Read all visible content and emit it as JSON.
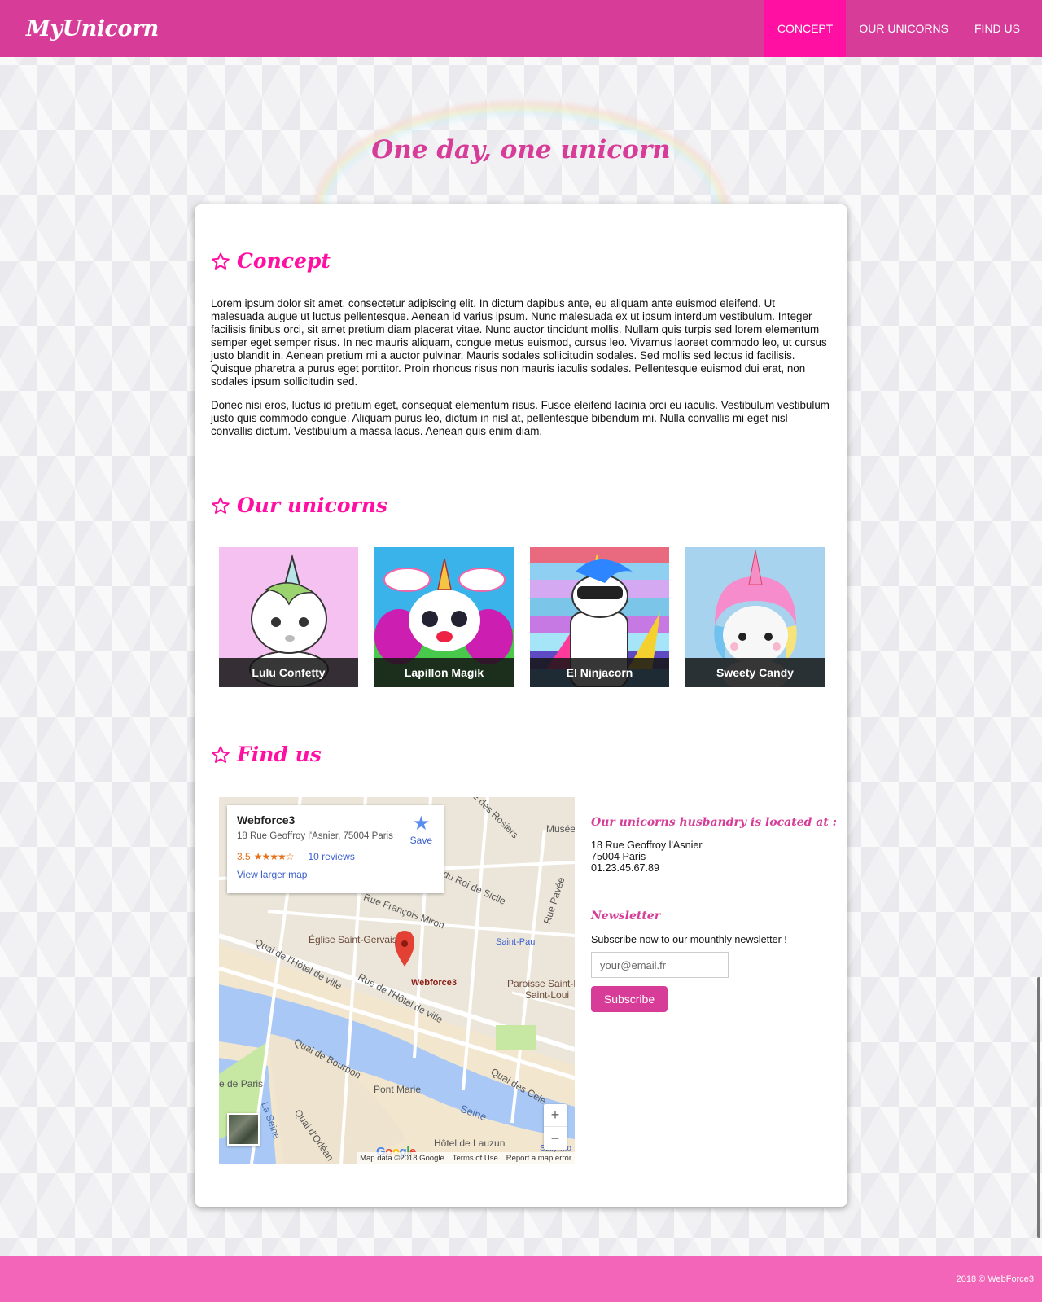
{
  "header": {
    "brand": "MyUnicorn",
    "nav": [
      {
        "label": "CONCEPT",
        "active": true
      },
      {
        "label": "OUR UNICORNS",
        "active": false
      },
      {
        "label": "FIND US",
        "active": false
      }
    ]
  },
  "hero": {
    "title": "One day, one unicorn"
  },
  "concept": {
    "title": "Concept",
    "paragraphs": [
      "Lorem ipsum dolor sit amet, consectetur adipiscing elit. In dictum dapibus ante, eu aliquam ante euismod eleifend. Ut malesuada augue ut luctus pellentesque. Aenean id varius ipsum. Nunc malesuada ex ut ipsum interdum vestibulum. Integer facilisis finibus orci, sit amet pretium diam placerat vitae. Nunc auctor tincidunt mollis. Nullam quis turpis sed lorem elementum semper eget semper risus. In nec mauris aliquam, congue metus euismod, cursus leo. Vivamus laoreet commodo leo, ut cursus justo blandit in. Aenean pretium mi a auctor pulvinar. Mauris sodales sollicitudin sodales. Sed mollis sed lectus id facilisis. Quisque pharetra a purus eget porttitor. Proin rhoncus risus non mauris iaculis sodales. Pellentesque euismod dui erat, non sodales ipsum sollicitudin sed.",
      "Donec nisi eros, luctus id pretium eget, consequat elementum risus. Fusce eleifend lacinia orci eu iaculis. Vestibulum vestibulum justo quis commodo congue. Aliquam purus leo, dictum in nisl at, pellentesque bibendum mi. Nulla convallis mi eget nisl convallis dictum. Vestibulum a massa lacus. Aenean quis enim diam."
    ]
  },
  "unicorns": {
    "title": "Our unicorns",
    "items": [
      {
        "name": "Lulu Confetty"
      },
      {
        "name": "Lapillon Magik"
      },
      {
        "name": "El Ninjacorn"
      },
      {
        "name": "Sweety Candy"
      }
    ]
  },
  "find_us": {
    "title": "Find us",
    "map": {
      "place_name": "Webforce3",
      "place_address": "18 Rue Geoffroy l'Asnier, 75004 Paris",
      "rating": "3.5",
      "stars": "★★★★☆",
      "reviews": "10 reviews",
      "larger_map": "View larger map",
      "save": "Save",
      "pin_label": "Webforce3",
      "labels": {
        "rue_rosiers": "Rue des Rosiers",
        "roi_sicile": "du Roi de Sicile",
        "rue_pavee": "Rue Pavée",
        "francois_miron": "Rue François Miron",
        "eglise": "Église Saint-Gervais",
        "saint_paul": "Saint-Paul",
        "quai_hotel": "Quai de l'Hôtel de ville",
        "rue_hotel": "Rue de l'Hôtel de ville",
        "paroisse": "Paroisse Saint-Pau",
        "paroisse2": "Saint-Loui",
        "quai_bourbon": "Quai de Bourbon",
        "pont_marie": "Pont Marie",
        "quai_celestins": "Quai des Céle",
        "seine": "Seine",
        "la_seine": "La Seine",
        "ile_paris": "e de Paris",
        "hotel_lauzun": "Hôtel de Lauzun",
        "quai_orleans": "Quai d'Orléan",
        "musee": "Musée C",
        "sully": "Sully-Mo"
      },
      "footer": [
        "Map data ©2018 Google",
        "Terms of Use",
        "Report a map error"
      ],
      "google": "Google",
      "zoom_in": "+",
      "zoom_out": "−"
    },
    "location_heading": "Our unicorns husbandry is located at :",
    "address_lines": [
      "18 Rue Geoffroy l'Asnier",
      "75004 Paris",
      "01.23.45.67.89"
    ],
    "newsletter_heading": "Newsletter",
    "newsletter_text": "Subscribe now to our mounthly newsletter !",
    "email_placeholder": "your@email.fr",
    "subscribe_label": "Subscribe"
  },
  "footer": {
    "copyright": "2018 © WebForce3"
  },
  "colors": {
    "header": "#d63c98",
    "active_nav": "#ff0fa2",
    "accent_title": "#ff0fa2",
    "footer": "#f365b8"
  }
}
